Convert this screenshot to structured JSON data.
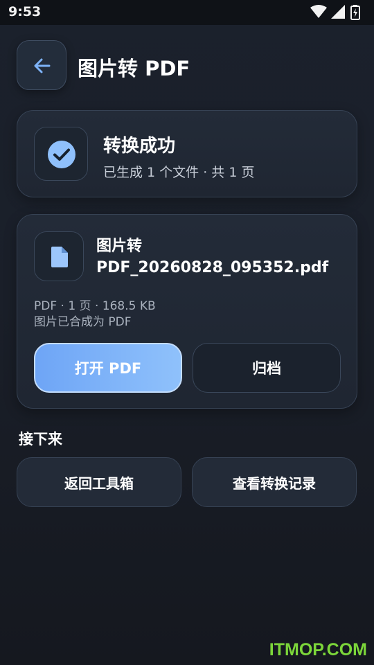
{
  "status_bar": {
    "time": "9:53",
    "icons": [
      "wifi-icon",
      "signal-icon",
      "battery-charging-icon"
    ]
  },
  "header": {
    "title": "图片转 PDF",
    "back_icon": "arrow-left-icon"
  },
  "success": {
    "title": "转换成功",
    "subtitle": "已生成 1 个文件 · 共 1 页",
    "icon": "check-circle-icon"
  },
  "file": {
    "name_line1": "图片转",
    "name_line2": "PDF_20260828_095352.pdf",
    "meta": "PDF · 1 页 · 168.5 KB",
    "description": "图片已合成为 PDF",
    "icon": "document-icon",
    "open_label": "打开 PDF",
    "archive_label": "归档"
  },
  "next": {
    "title": "接下来",
    "home_label": "返回工具箱",
    "history_label": "查看转换记录"
  },
  "watermark": "ITMOP.COM",
  "colors": {
    "accent": "#7eb3f8",
    "background": "#1a1f29",
    "watermark": "#7cd63a"
  }
}
